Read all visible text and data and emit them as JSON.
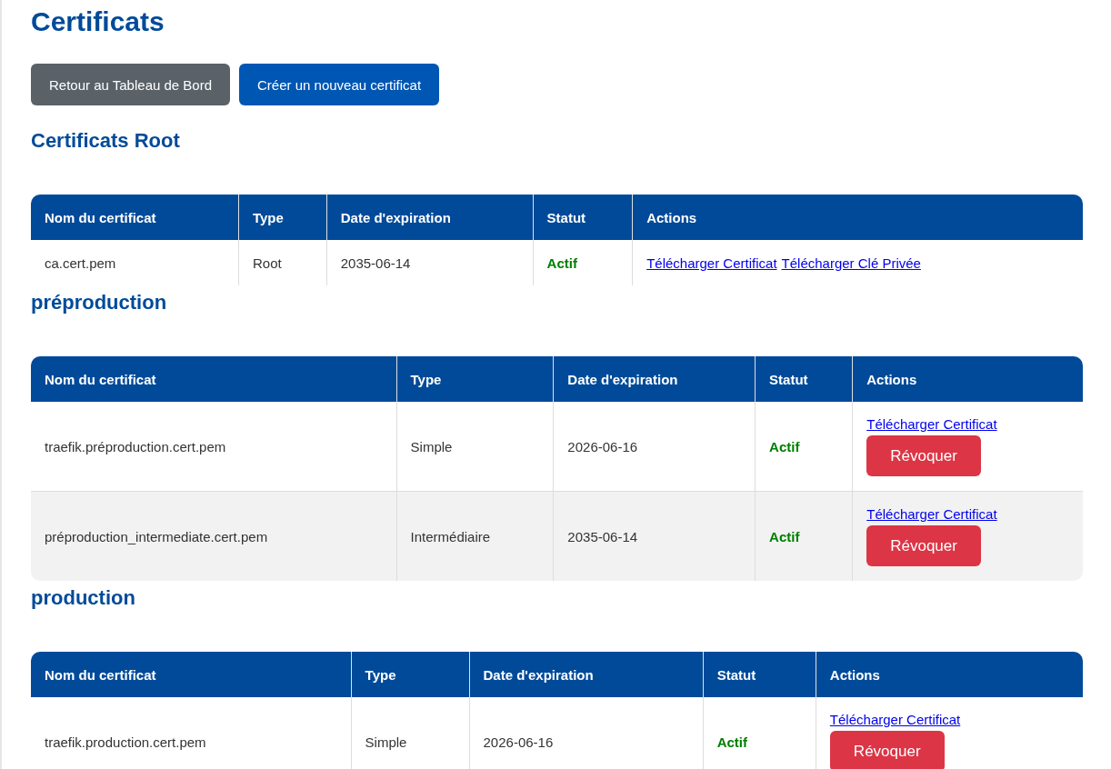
{
  "title": "Certificats",
  "top_buttons": [
    {
      "label": "Retour au Tableau de Bord",
      "kind": "secondary"
    },
    {
      "label": "Créer un nouveau certificat",
      "kind": "primary"
    }
  ],
  "sections": [
    {
      "title": "Certificats Root",
      "columns": [
        "Nom du certificat",
        "Type",
        "Date d'expiration",
        "Statut",
        "Actions"
      ],
      "rows": [
        {
          "name": "ca.cert.pem",
          "type": "Root",
          "expiration": "2035-06-14",
          "status": "Actif",
          "links": [
            "Télécharger Certificat",
            "Télécharger Clé Privée"
          ]
        }
      ]
    },
    {
      "title": "préproduction",
      "columns": [
        "Nom du certificat",
        "Type",
        "Date d'expiration",
        "Statut",
        "Actions"
      ],
      "rows": [
        {
          "name": "traefik.préproduction.cert.pem",
          "type": "Simple",
          "expiration": "2026-06-16",
          "status": "Actif",
          "links": [
            "Télécharger Certificat"
          ],
          "button": "Révoquer"
        },
        {
          "name": "préproduction_intermediate.cert.pem",
          "type": "Intermédiaire",
          "expiration": "2035-06-14",
          "status": "Actif",
          "links": [
            "Télécharger Certificat"
          ],
          "button": "Révoquer"
        }
      ]
    },
    {
      "title": "production",
      "columns": [
        "Nom du certificat",
        "Type",
        "Date d'expiration",
        "Statut",
        "Actions"
      ],
      "rows": [
        {
          "name": "traefik.production.cert.pem",
          "type": "Simple",
          "expiration": "2026-06-16",
          "status": "Actif",
          "links": [
            "Télécharger Certificat"
          ],
          "button": "Révoquer"
        }
      ]
    }
  ]
}
